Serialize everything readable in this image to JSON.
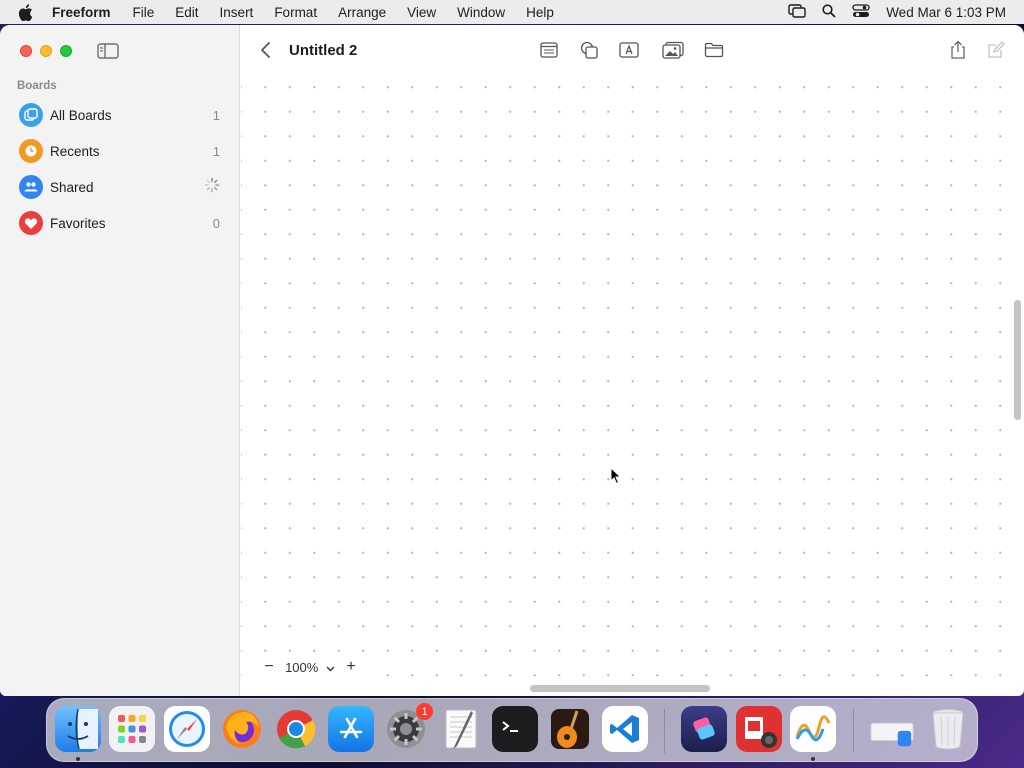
{
  "menubar": {
    "app_name": "Freeform",
    "items": [
      "File",
      "Edit",
      "Insert",
      "Format",
      "Arrange",
      "View",
      "Window",
      "Help"
    ],
    "clock": "Wed Mar 6  1:03 PM"
  },
  "sidebar": {
    "section_title": "Boards",
    "items": [
      {
        "label": "All Boards",
        "count": "1",
        "icon": "all-boards-icon",
        "color": "#3aa1e8"
      },
      {
        "label": "Recents",
        "count": "1",
        "icon": "clock-icon",
        "color": "#f09a24"
      },
      {
        "label": "Shared",
        "count": "",
        "icon": "people-icon",
        "color": "#2f86f0"
      },
      {
        "label": "Favorites",
        "count": "0",
        "icon": "heart-icon",
        "color": "#ea3f3f"
      }
    ]
  },
  "toolbar": {
    "title": "Untitled 2"
  },
  "zoom": {
    "value": "100%"
  },
  "dock": {
    "badge_settings": "1"
  }
}
